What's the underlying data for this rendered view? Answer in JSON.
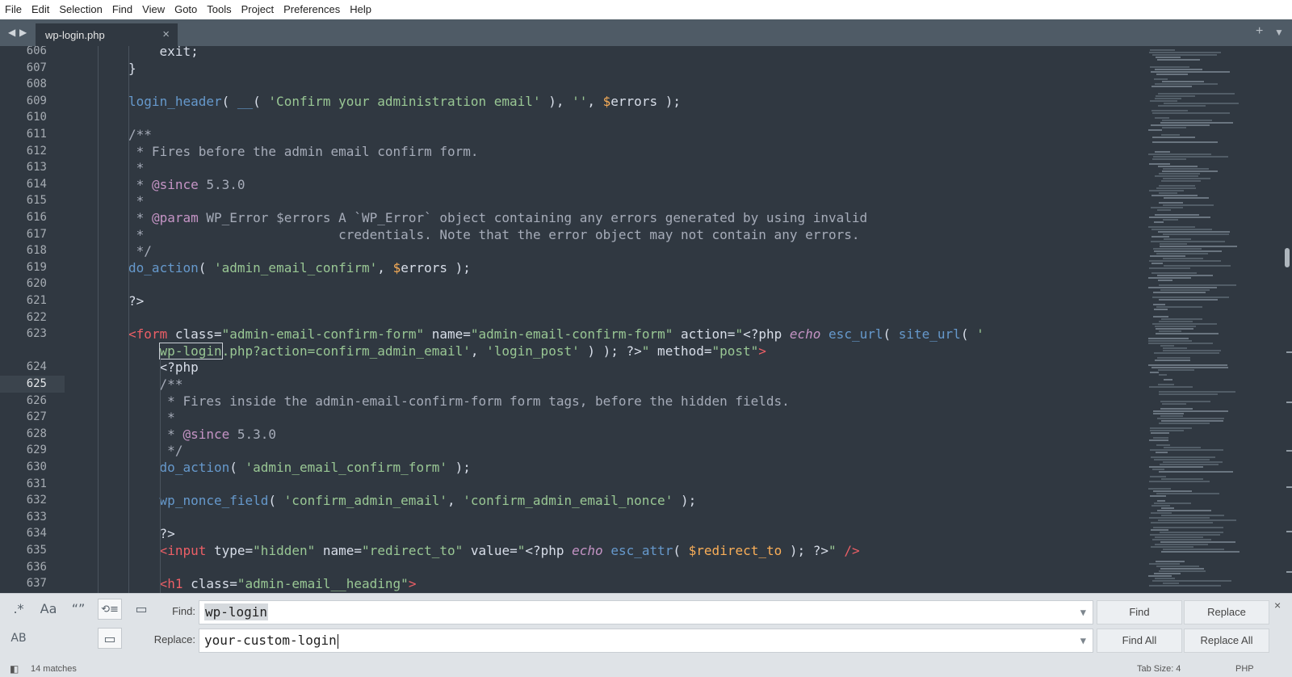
{
  "menu": [
    "File",
    "Edit",
    "Selection",
    "Find",
    "View",
    "Goto",
    "Tools",
    "Project",
    "Preferences",
    "Help"
  ],
  "tab": {
    "label": "wp-login.php",
    "close": "×"
  },
  "tabbar_icons": {
    "back": "◀",
    "forward": "▶",
    "new_tab": "+",
    "tab_list": "▼"
  },
  "editor": {
    "active_line": "625",
    "gutter": [
      "606",
      "607",
      "608",
      "609",
      "610",
      "611",
      "612",
      "613",
      "614",
      "615",
      "616",
      "617",
      "618",
      "619",
      "620",
      "621",
      "622",
      "623",
      "",
      "624",
      "625",
      "626",
      "627",
      "628",
      "629",
      "630",
      "631",
      "632",
      "633",
      "634",
      "635",
      "636",
      "637"
    ]
  },
  "code": {
    "l606": "exit;",
    "l607": "}",
    "l609": [
      {
        "t": "login_header",
        "c": "fn"
      },
      {
        "t": "( ",
        "c": "pl"
      },
      {
        "t": "__",
        "c": "fn"
      },
      {
        "t": "( ",
        "c": "pl"
      },
      {
        "t": "'Confirm your administration email'",
        "c": "str"
      },
      {
        "t": " ), ",
        "c": "pl"
      },
      {
        "t": "''",
        "c": "str"
      },
      {
        "t": ", ",
        "c": "pl"
      },
      {
        "t": "$",
        "c": "var"
      },
      {
        "t": "errors",
        "c": "pl"
      },
      {
        "t": " );",
        "c": "pl"
      }
    ],
    "l611": "/**",
    "l612": " * Fires before the admin email confirm form.",
    "l613": " *",
    "l614a": " * ",
    "l614b": "@since",
    "l614c": " 5.3.0",
    "l615": " *",
    "l616a": " * ",
    "l616b": "@param",
    "l616c": " WP_Error $errors A `WP_Error` object containing any errors generated by using invalid",
    "l617": " *                         credentials. Note that the error object may not contain any errors.",
    "l618": " */",
    "l619": [
      {
        "t": "do_action",
        "c": "fn"
      },
      {
        "t": "( ",
        "c": "pl"
      },
      {
        "t": "'admin_email_confirm'",
        "c": "str"
      },
      {
        "t": ", ",
        "c": "pl"
      },
      {
        "t": "$",
        "c": "var"
      },
      {
        "t": "errors",
        "c": "pl"
      },
      {
        "t": " );",
        "c": "pl"
      }
    ],
    "l621": "?>",
    "l623": [
      {
        "t": "<",
        "c": "tag"
      },
      {
        "t": "form",
        "c": "tag"
      },
      {
        "t": " class",
        "c": "attr"
      },
      {
        "t": "=",
        "c": "pl"
      },
      {
        "t": "\"admin-email-confirm-form\"",
        "c": "str"
      },
      {
        "t": " name",
        "c": "attr"
      },
      {
        "t": "=",
        "c": "pl"
      },
      {
        "t": "\"admin-email-confirm-form\"",
        "c": "str"
      },
      {
        "t": " action",
        "c": "attr"
      },
      {
        "t": "=",
        "c": "pl"
      },
      {
        "t": "\"",
        "c": "str"
      },
      {
        "t": "<?php ",
        "c": "php"
      },
      {
        "t": "echo",
        "c": "kw"
      },
      {
        "t": " ",
        "c": "pl"
      },
      {
        "t": "esc_url",
        "c": "fn"
      },
      {
        "t": "( ",
        "c": "pl"
      },
      {
        "t": "site_url",
        "c": "fn"
      },
      {
        "t": "( ",
        "c": "pl"
      },
      {
        "t": "'",
        "c": "str"
      }
    ],
    "l623b": [
      {
        "t": "wp-login",
        "c": "str",
        "box": true
      },
      {
        "t": ".php?action=confirm_admin_email'",
        "c": "str"
      },
      {
        "t": ", ",
        "c": "pl"
      },
      {
        "t": "'login_post'",
        "c": "str"
      },
      {
        "t": " ) ); ",
        "c": "pl"
      },
      {
        "t": "?>",
        "c": "php"
      },
      {
        "t": "\"",
        "c": "str"
      },
      {
        "t": " method",
        "c": "attr"
      },
      {
        "t": "=",
        "c": "pl"
      },
      {
        "t": "\"post\"",
        "c": "str"
      },
      {
        "t": ">",
        "c": "tag"
      }
    ],
    "l624": "<?php",
    "l625": "/**",
    "l626": " * Fires inside the admin-email-confirm-form form tags, before the hidden fields.",
    "l627": " *",
    "l628a": " * ",
    "l628b": "@since",
    "l628c": " 5.3.0",
    "l629": " */",
    "l630": [
      {
        "t": "do_action",
        "c": "fn"
      },
      {
        "t": "( ",
        "c": "pl"
      },
      {
        "t": "'admin_email_confirm_form'",
        "c": "str"
      },
      {
        "t": " );",
        "c": "pl"
      }
    ],
    "l632": [
      {
        "t": "wp_nonce_field",
        "c": "fn"
      },
      {
        "t": "( ",
        "c": "pl"
      },
      {
        "t": "'confirm_admin_email'",
        "c": "str"
      },
      {
        "t": ", ",
        "c": "pl"
      },
      {
        "t": "'confirm_admin_email_nonce'",
        "c": "str"
      },
      {
        "t": " );",
        "c": "pl"
      }
    ],
    "l634": "?>",
    "l635": [
      {
        "t": "<",
        "c": "tag"
      },
      {
        "t": "input",
        "c": "tag"
      },
      {
        "t": " type",
        "c": "attr"
      },
      {
        "t": "=",
        "c": "pl"
      },
      {
        "t": "\"hidden\"",
        "c": "str"
      },
      {
        "t": " name",
        "c": "attr"
      },
      {
        "t": "=",
        "c": "pl"
      },
      {
        "t": "\"redirect_to\"",
        "c": "str"
      },
      {
        "t": " value",
        "c": "attr"
      },
      {
        "t": "=",
        "c": "pl"
      },
      {
        "t": "\"",
        "c": "str"
      },
      {
        "t": "<?php ",
        "c": "php"
      },
      {
        "t": "echo",
        "c": "kw"
      },
      {
        "t": " ",
        "c": "pl"
      },
      {
        "t": "esc_attr",
        "c": "fn"
      },
      {
        "t": "( ",
        "c": "pl"
      },
      {
        "t": "$redirect_to",
        "c": "var"
      },
      {
        "t": " ); ",
        "c": "pl"
      },
      {
        "t": "?>",
        "c": "php"
      },
      {
        "t": "\"",
        "c": "str"
      },
      {
        "t": " />",
        "c": "tag"
      }
    ],
    "l637": [
      {
        "t": "<",
        "c": "tag"
      },
      {
        "t": "h1",
        "c": "tag"
      },
      {
        "t": " class",
        "c": "attr"
      },
      {
        "t": "=",
        "c": "pl"
      },
      {
        "t": "\"admin-email__heading\"",
        "c": "str"
      },
      {
        "t": ">",
        "c": "tag"
      }
    ]
  },
  "find_panel": {
    "options": {
      "regex": ".*",
      "case": "Aa",
      "whole_word": "“”",
      "wrap": "⟲≡",
      "in_selection": "▭",
      "preserve_case": "AB",
      "highlight": "▭"
    },
    "find_label": "Find:",
    "find_value": "wp-login",
    "replace_label": "Replace:",
    "replace_value": "your-custom-login",
    "buttons": {
      "find": "Find",
      "replace": "Replace",
      "find_all": "Find All",
      "replace_all": "Replace All"
    },
    "close": "×"
  },
  "status": {
    "matches": "14 matches",
    "tab_size": "Tab Size: 4",
    "syntax": "PHP"
  }
}
